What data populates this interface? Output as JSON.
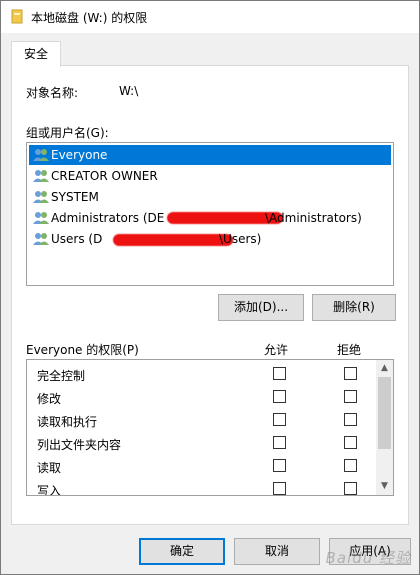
{
  "window": {
    "title": "本地磁盘 (W:) 的权限"
  },
  "tabs": [
    {
      "label": "安全"
    }
  ],
  "object": {
    "label": "对象名称:",
    "value": "W:\\"
  },
  "users": {
    "label": "组或用户名(G):",
    "items": [
      {
        "name": "Everyone",
        "selected": true
      },
      {
        "name": "CREATOR OWNER",
        "selected": false
      },
      {
        "name": "SYSTEM",
        "selected": false
      },
      {
        "prefix": "Administrators (DE",
        "suffix": "\\Administrators)",
        "selected": false
      },
      {
        "prefix": "Users (D",
        "suffix": "\\Users)",
        "selected": false
      }
    ]
  },
  "buttons": {
    "add": "添加(D)...",
    "remove": "删除(R)",
    "ok": "确定",
    "cancel": "取消",
    "apply": "应用(A)"
  },
  "permissions": {
    "title": "Everyone 的权限(P)",
    "allow_header": "允许",
    "deny_header": "拒绝",
    "items": [
      {
        "name": "完全控制",
        "allow": false,
        "deny": false
      },
      {
        "name": "修改",
        "allow": false,
        "deny": false
      },
      {
        "name": "读取和执行",
        "allow": false,
        "deny": false
      },
      {
        "name": "列出文件夹内容",
        "allow": false,
        "deny": false
      },
      {
        "name": "读取",
        "allow": false,
        "deny": false
      },
      {
        "name": "写入",
        "allow": false,
        "deny": false
      }
    ]
  },
  "watermark": "Baidu 经验",
  "colors": {
    "selection": "#0078d7",
    "redaction": "#ee1111"
  }
}
